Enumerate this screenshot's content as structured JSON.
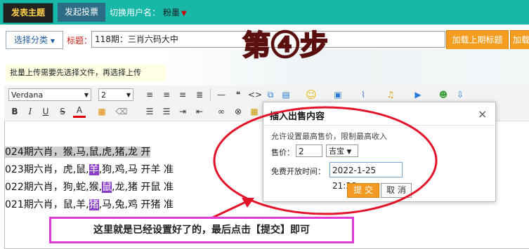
{
  "top": {
    "tabs": [
      "发表主题",
      "发起投票"
    ],
    "switch_label": "切换用户名：",
    "username": "粉墨",
    "username_arrow": "▼"
  },
  "form": {
    "category_btn": "选择分类",
    "category_arrow": "▼",
    "title_label": "标题：",
    "title_value": "118期：三肖六码大中",
    "load_prev_btn": "加载上期标题",
    "load_btn2": "加载"
  },
  "step_label": "第④步",
  "upload_tip": "批量上传需要先选择文件，再选择上传",
  "editor": {
    "font": "Verdana",
    "size": "2",
    "content_lines": [
      {
        "parts": [
          {
            "t": "024期六肖，猴,马,鼠,虎,猪,龙 开",
            "s": "hl"
          }
        ]
      },
      {
        "parts": [
          {
            "t": "023期六肖，虎,鼠,"
          },
          {
            "t": "羊",
            "s": "pur"
          },
          {
            "t": ",狗,鸡,马 开羊 准"
          }
        ]
      },
      {
        "parts": [
          {
            "t": "022期六肖，狗,蛇,猴,"
          },
          {
            "t": "鼠",
            "s": "pur"
          },
          {
            "t": ",龙,猪 开鼠 准"
          }
        ]
      },
      {
        "parts": [
          {
            "t": "021期六肖，鼠,羊,"
          },
          {
            "t": "猪",
            "s": "pur"
          },
          {
            "t": ",马,兔,鸡 开猪 准"
          }
        ]
      }
    ]
  },
  "dialog": {
    "title": "插入出售内容",
    "close": "×",
    "description": "允许设置最高售价，限制最高收入",
    "price_label": "售价：",
    "price_value": "2",
    "unit": "吉宝",
    "unit_arrow": "▼",
    "free_time_label": "免费开放时间：",
    "free_time_value": "2022-1-25 21:30",
    "submit": "提 交",
    "cancel": "取 消"
  },
  "annotation": "这里就是已经设置好了的，最后点击【提交】即可",
  "colors": {
    "topbar": "#18b7a8",
    "accent_orange": "#f49d1f",
    "annotation_red": "#e3142a",
    "annotation_pink": "#e23ad8",
    "highlight_purple": "#8b3fc9"
  }
}
